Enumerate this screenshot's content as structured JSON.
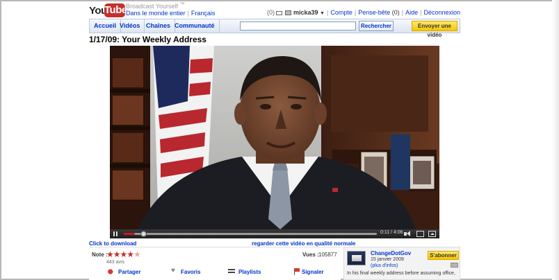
{
  "logo": {
    "you": "You",
    "tube": "Tube"
  },
  "header": {
    "tagline": "Broadcast Yourself",
    "tagline_mark": "™",
    "world_link": "Dans le monde entier",
    "language_link": "Français"
  },
  "user_bar": {
    "mail_count": "(0)",
    "username": "micka39",
    "account_link": "Compte",
    "notes_link": "Pense-bête",
    "notes_count": "(0)",
    "help_link": "Aide",
    "logout_link": "Déconnexion"
  },
  "nav": {
    "tabs": [
      "Accueil",
      "Vidéos",
      "Chaînes",
      "Communauté"
    ],
    "search_button": "Rechercher",
    "upload_button": "Envoyer une vidéo"
  },
  "video": {
    "title": "1/17/09: Your Weekly Address",
    "time": "0:11 / 4:06",
    "progress": 0.045
  },
  "below_player": {
    "download_link": "Click to download",
    "quality_link": "regarder cette vidéo en qualité normale"
  },
  "info": {
    "rating_label": "Note :",
    "rating_stars": 4.5,
    "ratings_count": "443 avis",
    "views_label": "Vues :",
    "views_value": "105877",
    "actions": [
      "Partager",
      "Favoris",
      "Playlists",
      "Signaler"
    ]
  },
  "channel": {
    "name": "ChangeDotGov",
    "date": "15 janvier 2009",
    "more_info": "(plus d'infos)",
    "subscribe": "S'abonner",
    "description": "In his final weekly address before assuming office,"
  },
  "colors": {
    "brand_red": "#c4302b",
    "link_blue": "#0033cc",
    "accent_yellow": "#f7c600"
  }
}
